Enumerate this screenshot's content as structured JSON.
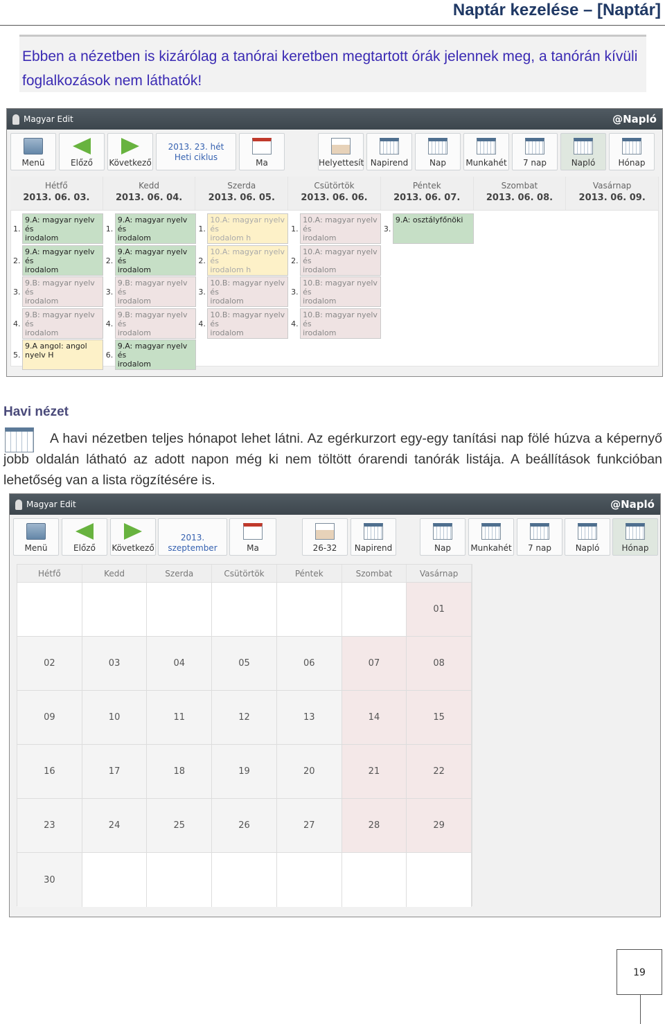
{
  "header": {
    "title": "Naptár kezelése – [Naptár]"
  },
  "note": "Ebben a nézetben is kizárólag a tanórai keretben megtartott órák jelennek meg, a tanórán kívüli foglalkozások nem láthatók!",
  "app1": {
    "user": "Magyar Edit",
    "brand": "@Napló",
    "toolbar": {
      "menu": "Menü",
      "prev": "Előző",
      "next": "Következő",
      "week_line1": "2013. 23. hét",
      "week_line2": "Heti ciklus",
      "today": "Ma",
      "helyettesit": "Helyettesít",
      "napirend": "Napirend",
      "nap": "Nap",
      "munkahet": "Munkahét",
      "nap7": "7 nap",
      "naplo": "Napló",
      "honap": "Hónap"
    },
    "days": [
      {
        "name": "Hétfő",
        "date": "2013. 06. 03."
      },
      {
        "name": "Kedd",
        "date": "2013. 06. 04."
      },
      {
        "name": "Szerda",
        "date": "2013. 06. 05."
      },
      {
        "name": "Csütörtök",
        "date": "2013. 06. 06."
      },
      {
        "name": "Péntek",
        "date": "2013. 06. 07."
      },
      {
        "name": "Szombat",
        "date": "2013. 06. 08."
      },
      {
        "name": "Vasárnap",
        "date": "2013. 06. 09."
      }
    ],
    "lessons": [
      {
        "day": 0,
        "num": "1.",
        "l1": "9.A: magyar nyelv és",
        "l2": "irodalom",
        "style": "green",
        "slot": 0
      },
      {
        "day": 0,
        "num": "2.",
        "l1": "9.A: magyar nyelv és",
        "l2": "irodalom",
        "style": "green",
        "slot": 1
      },
      {
        "day": 0,
        "num": "3.",
        "l1": "9.B: magyar nyelv és",
        "l2": "irodalom",
        "style": "red",
        "slot": 2
      },
      {
        "day": 0,
        "num": "4.",
        "l1": "9.B: magyar nyelv és",
        "l2": "irodalom",
        "style": "red",
        "slot": 3
      },
      {
        "day": 0,
        "num": "5.",
        "l1": "9.A angol: angol nyelv H",
        "l2": "",
        "style": "yellowdark",
        "slot": 4
      },
      {
        "day": 1,
        "num": "1.",
        "l1": "9.A: magyar nyelv és",
        "l2": "irodalom",
        "style": "green",
        "slot": 0
      },
      {
        "day": 1,
        "num": "2.",
        "l1": "9.A: magyar nyelv és",
        "l2": "irodalom",
        "style": "green",
        "slot": 1
      },
      {
        "day": 1,
        "num": "3.",
        "l1": "9.B: magyar nyelv és",
        "l2": "irodalom",
        "style": "red",
        "slot": 2
      },
      {
        "day": 1,
        "num": "4.",
        "l1": "9.B: magyar nyelv és",
        "l2": "irodalom",
        "style": "red",
        "slot": 3
      },
      {
        "day": 1,
        "num": "6.",
        "l1": "9.A: magyar nyelv és",
        "l2": "irodalom",
        "style": "green",
        "slot": 4
      },
      {
        "day": 2,
        "num": "1.",
        "l1": "10.A: magyar nyelv és",
        "l2": "irodalom h",
        "style": "yellow",
        "slot": 0
      },
      {
        "day": 2,
        "num": "2.",
        "l1": "10.A: magyar nyelv és",
        "l2": "irodalom h",
        "style": "yellow",
        "slot": 1
      },
      {
        "day": 2,
        "num": "3.",
        "l1": "10.B: magyar nyelv és",
        "l2": "irodalom",
        "style": "red",
        "slot": 2
      },
      {
        "day": 2,
        "num": "4.",
        "l1": "10.B: magyar nyelv és",
        "l2": "irodalom",
        "style": "red",
        "slot": 3
      },
      {
        "day": 3,
        "num": "1.",
        "l1": "10.A: magyar nyelv és",
        "l2": "irodalom",
        "style": "red",
        "slot": 0
      },
      {
        "day": 3,
        "num": "2.",
        "l1": "10.A: magyar nyelv és",
        "l2": "irodalom",
        "style": "red",
        "slot": 1
      },
      {
        "day": 3,
        "num": "3.",
        "l1": "10.B: magyar nyelv és",
        "l2": "irodalom",
        "style": "red",
        "slot": 2
      },
      {
        "day": 3,
        "num": "4.",
        "l1": "10.B: magyar nyelv és",
        "l2": "irodalom",
        "style": "red",
        "slot": 3
      },
      {
        "day": 4,
        "num": "3.",
        "l1": "9.A: osztályfőnöki",
        "l2": "",
        "style": "green",
        "slot": 0
      }
    ]
  },
  "section": {
    "title": "Havi nézet",
    "para": "A havi nézetben teljes hónapot lehet látni. Az egérkurzort egy-egy tanítási nap fölé húzva a képernyő jobb oldalán látható az adott napon még ki nem töltött órarendi tanórák listája. A beállítások funkcióban lehetőség van a lista rögzítésére is."
  },
  "app2": {
    "user": "Magyar Edit",
    "brand": "@Napló",
    "toolbar": {
      "menu": "Menü",
      "prev": "Előző",
      "next": "Következő",
      "month": "2013. szeptember",
      "today": "Ma",
      "weeks": "26-32",
      "napirend": "Napirend",
      "nap": "Nap",
      "munkahet": "Munkahét",
      "nap7": "7 nap",
      "naplo": "Napló",
      "honap": "Hónap"
    },
    "weekdays": [
      "Hétfő",
      "Kedd",
      "Szerda",
      "Csütörtök",
      "Péntek",
      "Szombat",
      "Vasárnap"
    ],
    "weeks": [
      [
        "",
        "",
        "",
        "",
        "",
        "",
        "01"
      ],
      [
        "02",
        "03",
        "04",
        "05",
        "06",
        "07",
        "08"
      ],
      [
        "09",
        "10",
        "11",
        "12",
        "13",
        "14",
        "15"
      ],
      [
        "16",
        "17",
        "18",
        "19",
        "20",
        "21",
        "22"
      ],
      [
        "23",
        "24",
        "25",
        "26",
        "27",
        "28",
        "29"
      ],
      [
        "30",
        "",
        "",
        "",
        "",
        "",
        ""
      ]
    ]
  },
  "page_number": "19"
}
